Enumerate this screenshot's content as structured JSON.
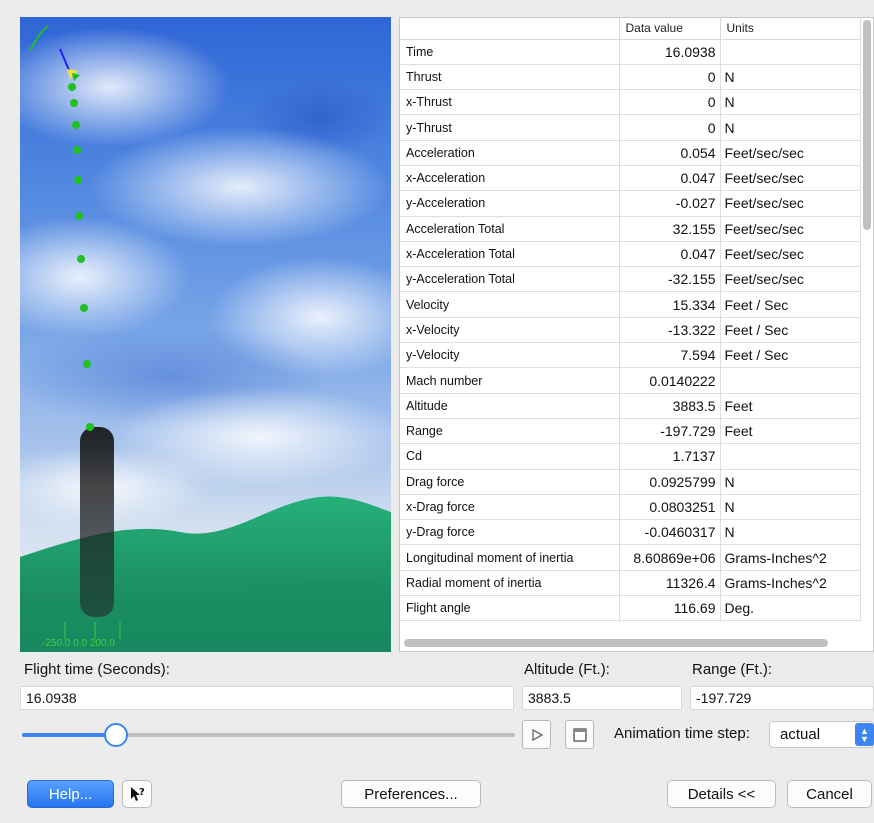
{
  "viewport": {
    "axis_labels": "-250.0  0.0 200.0"
  },
  "table": {
    "headers": [
      "",
      "Data value",
      "Units"
    ],
    "rows": [
      {
        "name": "Time",
        "value": "16.0938",
        "unit": ""
      },
      {
        "name": "Thrust",
        "value": "0",
        "unit": "N"
      },
      {
        "name": "x-Thrust",
        "value": "0",
        "unit": "N"
      },
      {
        "name": "y-Thrust",
        "value": "0",
        "unit": "N"
      },
      {
        "name": "Acceleration",
        "value": "0.054",
        "unit": "Feet/sec/sec"
      },
      {
        "name": "x-Acceleration",
        "value": "0.047",
        "unit": "Feet/sec/sec"
      },
      {
        "name": "y-Acceleration",
        "value": "-0.027",
        "unit": "Feet/sec/sec"
      },
      {
        "name": "Acceleration Total",
        "value": "32.155",
        "unit": "Feet/sec/sec"
      },
      {
        "name": "x-Acceleration Total",
        "value": "0.047",
        "unit": "Feet/sec/sec"
      },
      {
        "name": "y-Acceleration Total",
        "value": "-32.155",
        "unit": "Feet/sec/sec"
      },
      {
        "name": "Velocity",
        "value": "15.334",
        "unit": "Feet / Sec"
      },
      {
        "name": "x-Velocity",
        "value": "-13.322",
        "unit": "Feet / Sec"
      },
      {
        "name": "y-Velocity",
        "value": "7.594",
        "unit": "Feet / Sec"
      },
      {
        "name": "Mach number",
        "value": "0.0140222",
        "unit": ""
      },
      {
        "name": "Altitude",
        "value": "3883.5",
        "unit": "Feet"
      },
      {
        "name": "Range",
        "value": "-197.729",
        "unit": "Feet"
      },
      {
        "name": "Cd",
        "value": "1.7137",
        "unit": ""
      },
      {
        "name": "Drag force",
        "value": "0.0925799",
        "unit": "N"
      },
      {
        "name": "x-Drag force",
        "value": "0.0803251",
        "unit": "N"
      },
      {
        "name": "y-Drag force",
        "value": "-0.0460317",
        "unit": "N"
      },
      {
        "name": "Longitudinal moment of inertia",
        "value": "8.60869e+06",
        "unit": "Grams-Inches^2"
      },
      {
        "name": "Radial moment of inertia",
        "value": "11326.4",
        "unit": "Grams-Inches^2"
      },
      {
        "name": "Flight angle",
        "value": "116.69",
        "unit": "Deg."
      }
    ]
  },
  "form": {
    "flight_time_label": "Flight time (Seconds):",
    "flight_time_value": "16.0938",
    "altitude_label": "Altitude (Ft.):",
    "altitude_value": "3883.5",
    "range_label": "Range (Ft.):",
    "range_value": "-197.729",
    "slider_value": 0.19,
    "anim_step_label": "Animation time step:",
    "anim_step_value": "actual"
  },
  "buttons": {
    "help": "Help...",
    "preferences": "Preferences...",
    "details": "Details <<",
    "cancel": "Cancel"
  },
  "colors": {
    "accent": "#3d86f0",
    "trajectory": "#1fc01f",
    "ground": "#1e9a6a"
  },
  "icons": {
    "play": "play-icon",
    "stop": "stop-icon",
    "context_help": "context-help-icon",
    "select_arrows": "updown-arrows-icon"
  }
}
